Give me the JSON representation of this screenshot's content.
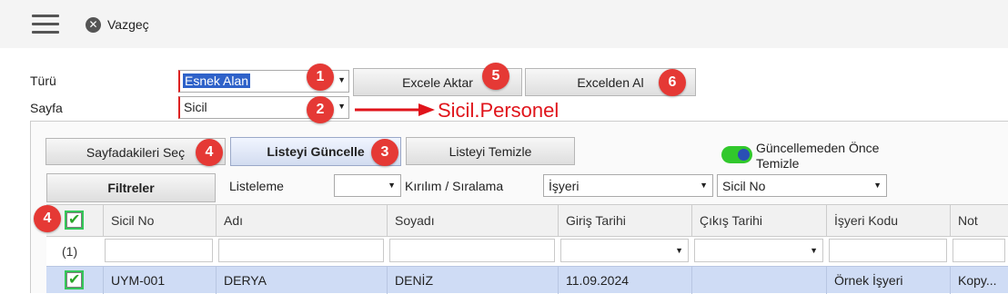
{
  "topbar": {
    "cancel_label": "Vazgeç"
  },
  "form": {
    "turu_label": "Türü",
    "turu_value": "Esnek Alan",
    "sayfa_label": "Sayfa",
    "sayfa_value": "Sicil"
  },
  "toolbar": {
    "excel_export": "Excele Aktar",
    "excel_import": "Excelden Al",
    "select_page": "Sayfadakileri Seç",
    "refresh_list": "Listeyi Güncelle",
    "clear_list": "Listeyi Temizle",
    "toggle_label": "Güncellemeden Önce Temizle",
    "toggle_on": true
  },
  "filters": {
    "button": "Filtreler",
    "listeleme_label": "Listeleme",
    "listeleme_value": "",
    "kirilim_label": "Kırılım / Sıralama",
    "kirilim_value1": "İşyeri",
    "kirilim_value2": "Sicil No"
  },
  "annotations": {
    "badges": [
      "1",
      "2",
      "5",
      "6",
      "4",
      "3",
      "4"
    ],
    "arrow_text": "Sicil.Personel",
    "color": "#e53935"
  },
  "grid": {
    "columns": [
      "Sicil No",
      "Adı",
      "Soyadı",
      "Giriş Tarihi",
      "Çıkış Tarihi",
      "İşyeri Kodu",
      "Not"
    ],
    "filter_count": "(1)",
    "rows": [
      {
        "sicil_no": "UYM-001",
        "adi": "DERYA",
        "soyadi": "DENİZ",
        "giris": "11.09.2024",
        "cikis": "",
        "isyeri": "Örnek İşyeri",
        "not": "Kopy..."
      }
    ]
  }
}
